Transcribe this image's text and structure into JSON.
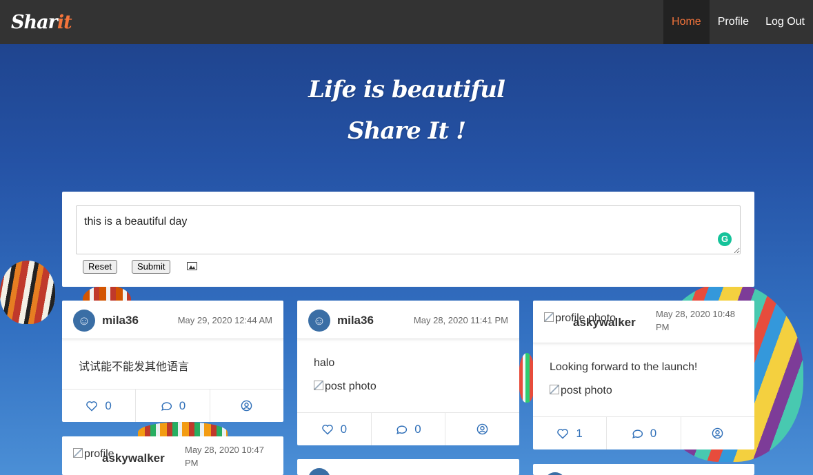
{
  "navbar": {
    "brand_main": "Shar",
    "brand_accent": "it",
    "items": [
      {
        "label": "Home",
        "active": true
      },
      {
        "label": "Profile",
        "active": false
      },
      {
        "label": "Log Out",
        "active": false
      }
    ],
    "accent_color": "#f4743b"
  },
  "hero": {
    "line1": "Life is beautiful",
    "line2": "Share It !"
  },
  "composer": {
    "text": "this is a beautiful day",
    "reset_label": "Reset",
    "submit_label": "Submit",
    "grammarly_label": "G"
  },
  "posts": [
    {
      "username": "mila36",
      "timestamp": "May 29, 2020 12:44 AM",
      "text": "试试能不能发其他语言",
      "likes": "0",
      "comments": "0"
    },
    {
      "username": "mila36",
      "timestamp": "May 28, 2020 11:41 PM",
      "text": "halo",
      "photo_alt": "post photo",
      "likes": "0",
      "comments": "0"
    },
    {
      "username": "askywalker",
      "avatar_alt": "profile photo",
      "timestamp_line1": "May 28, 2020 10:48",
      "timestamp_line2": "PM",
      "text": "Looking forward to the launch!",
      "photo_alt": "post photo",
      "likes": "1",
      "comments": "0"
    },
    {
      "username": "askywalker",
      "avatar_alt": "profile",
      "timestamp_line1": "May 28, 2020 10:47",
      "timestamp_line2": "PM"
    }
  ]
}
